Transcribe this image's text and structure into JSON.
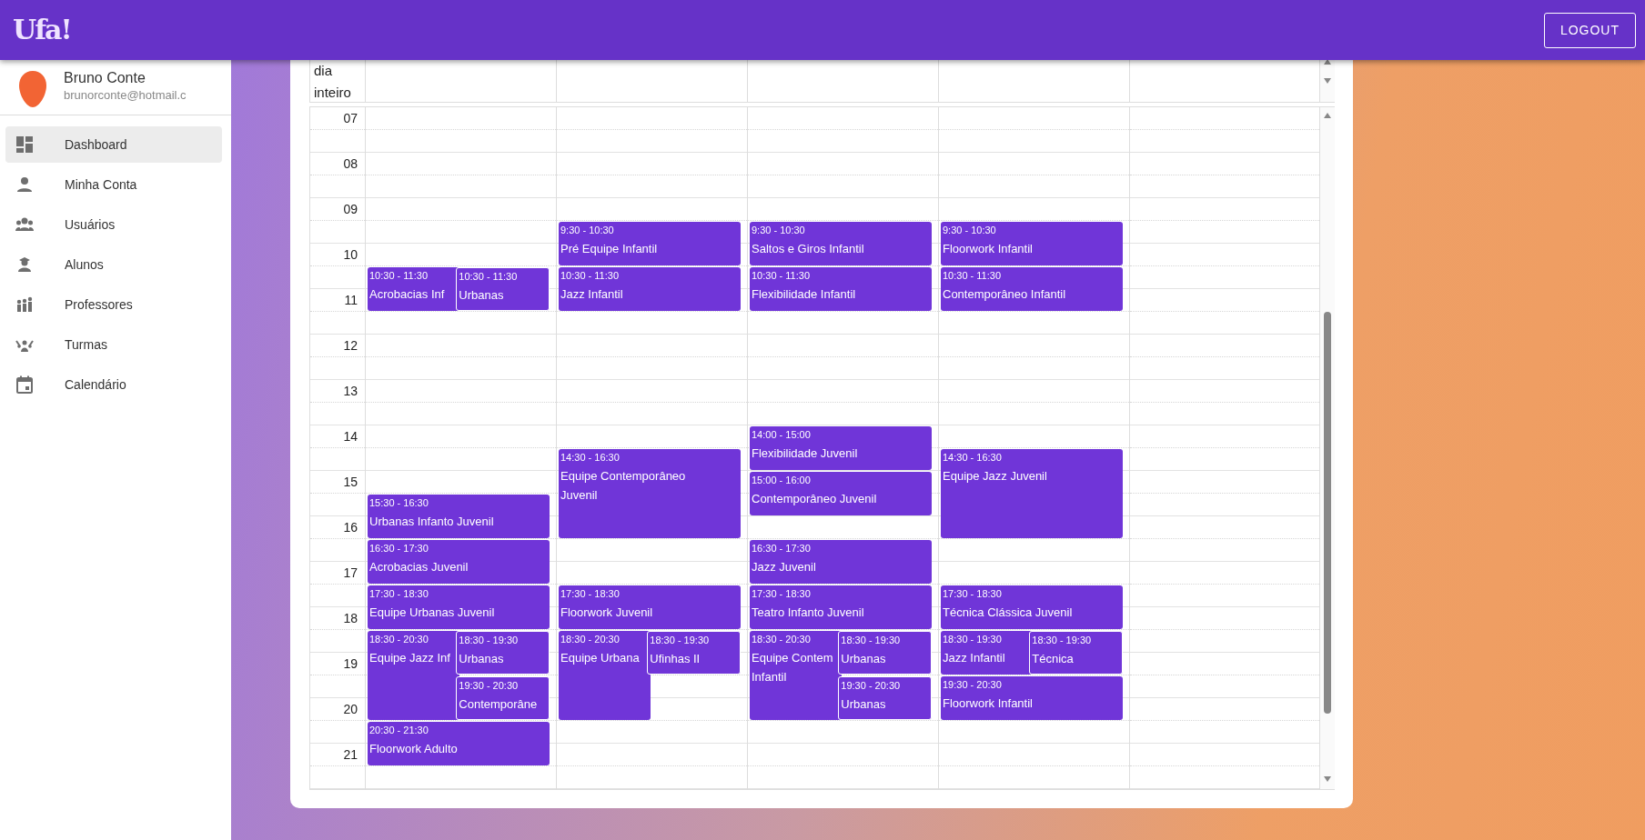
{
  "navbar": {
    "logo": "Ufa!",
    "logout": "LOGOUT"
  },
  "user": {
    "name": "Bruno Conte",
    "email": "brunorconte@hotmail.c"
  },
  "menu": [
    {
      "label": "Dashboard",
      "selected": true
    },
    {
      "label": "Minha Conta",
      "selected": false
    },
    {
      "label": "Usuários",
      "selected": false
    },
    {
      "label": "Alunos",
      "selected": false
    },
    {
      "label": "Professores",
      "selected": false
    },
    {
      "label": "Turmas",
      "selected": false
    },
    {
      "label": "Calendário",
      "selected": false
    }
  ],
  "calendar": {
    "all_day_label": "dia inteiro",
    "hours": [
      "07",
      "08",
      "09",
      "10",
      "11",
      "12",
      "13",
      "14",
      "15",
      "16",
      "17",
      "18",
      "19",
      "20",
      "21"
    ],
    "days": [
      {
        "events": [
          {
            "time": "10:30 - 11:30",
            "title": "Acrobacias Inf",
            "kind": "left"
          },
          {
            "time": "10:30 - 11:30",
            "title": "Urbanas",
            "kind": "right"
          },
          {
            "time": "15:30 - 16:30",
            "title": "Urbanas Infanto Juvenil",
            "kind": "full"
          },
          {
            "time": "16:30 - 17:30",
            "title": "Acrobacias Juvenil",
            "kind": "full"
          },
          {
            "time": "17:30 - 18:30",
            "title": "Equipe Urbanas Juvenil",
            "kind": "full"
          },
          {
            "time": "18:30 - 20:30",
            "title": "Equipe Jazz Inf",
            "kind": "left"
          },
          {
            "time": "18:30 - 19:30",
            "title": "Urbanas",
            "kind": "right"
          },
          {
            "time": "19:30 - 20:30",
            "title": "Contemporâne",
            "kind": "right"
          },
          {
            "time": "20:30 - 21:30",
            "title": "Floorwork Adulto",
            "kind": "full"
          }
        ]
      },
      {
        "events": [
          {
            "time": "9:30 - 10:30",
            "title": "Pré Equipe Infantil",
            "kind": "full"
          },
          {
            "time": "10:30 - 11:30",
            "title": "Jazz Infantil",
            "kind": "full"
          },
          {
            "time": "14:30 - 16:30",
            "title": "Equipe Contemporâneo\nJuvenil",
            "kind": "full"
          },
          {
            "time": "17:30 - 18:30",
            "title": "Floorwork Juvenil",
            "kind": "full"
          },
          {
            "time": "18:30 - 20:30",
            "title": "Equipe Urbana",
            "kind": "left"
          },
          {
            "time": "18:30 - 19:30",
            "title": "Ufinhas II",
            "kind": "right"
          }
        ]
      },
      {
        "events": [
          {
            "time": "9:30 - 10:30",
            "title": "Saltos e Giros Infantil",
            "kind": "full"
          },
          {
            "time": "10:30 - 11:30",
            "title": "Flexibilidade Infantil",
            "kind": "full"
          },
          {
            "time": "14:00 - 15:00",
            "title": "Flexibilidade Juvenil",
            "kind": "full"
          },
          {
            "time": "15:00 - 16:00",
            "title": "Contemporâneo Juvenil",
            "kind": "full"
          },
          {
            "time": "16:30 - 17:30",
            "title": "Jazz Juvenil",
            "kind": "full"
          },
          {
            "time": "17:30 - 18:30",
            "title": "Teatro Infanto Juvenil",
            "kind": "full"
          },
          {
            "time": "18:30 - 20:30",
            "title": "Equipe Contem\nInfantil",
            "kind": "left"
          },
          {
            "time": "18:30 - 19:30",
            "title": "Urbanas",
            "kind": "right"
          },
          {
            "time": "19:30 - 20:30",
            "title": "Urbanas",
            "kind": "right"
          }
        ]
      },
      {
        "events": [
          {
            "time": "9:30 - 10:30",
            "title": "Floorwork Infantil",
            "kind": "full"
          },
          {
            "time": "10:30 - 11:30",
            "title": "Contemporâneo Infantil",
            "kind": "full"
          },
          {
            "time": "14:30 - 16:30",
            "title": "Equipe Jazz Juvenil",
            "kind": "full"
          },
          {
            "time": "17:30 - 18:30",
            "title": "Técnica Clássica Juvenil",
            "kind": "full"
          },
          {
            "time": "18:30 - 19:30",
            "title": "Jazz Infantil",
            "kind": "left"
          },
          {
            "time": "18:30 - 19:30",
            "title": "Técnica",
            "kind": "right"
          },
          {
            "time": "19:30 - 20:30",
            "title": "Floorwork Infantil",
            "kind": "full"
          }
        ]
      }
    ]
  }
}
